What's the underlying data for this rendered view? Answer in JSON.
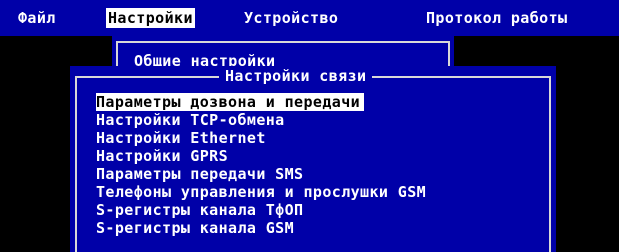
{
  "menubar": {
    "items": [
      {
        "label": "Файл"
      },
      {
        "label": "Настройки"
      },
      {
        "label": "Устройство"
      },
      {
        "label": "Протокол работы"
      }
    ],
    "active_index": 1
  },
  "settings_menu": {
    "first_item": "Общие настройки"
  },
  "connection_submenu": {
    "title": "Настройки связи",
    "items": [
      {
        "label": "Параметры дозвона и передачи",
        "selected": true
      },
      {
        "label": "Настройки TCP-обмена",
        "selected": false
      },
      {
        "label": "Настройки Ethernet",
        "selected": false
      },
      {
        "label": "Настройки GPRS",
        "selected": false
      },
      {
        "label": "Параметры передачи SMS",
        "selected": false
      },
      {
        "label": "Телефоны управления и прослушки GSM",
        "selected": false
      },
      {
        "label": "S-регистры канала ТфОП",
        "selected": false
      },
      {
        "label": "S-регистры канала GSM",
        "selected": false
      }
    ]
  },
  "colors": {
    "background": "#000000",
    "menu_bg": "#0000a8",
    "text": "#ffffff",
    "highlight_bg": "#ffffff",
    "highlight_text": "#000000",
    "frame": "#d8d8d8"
  }
}
